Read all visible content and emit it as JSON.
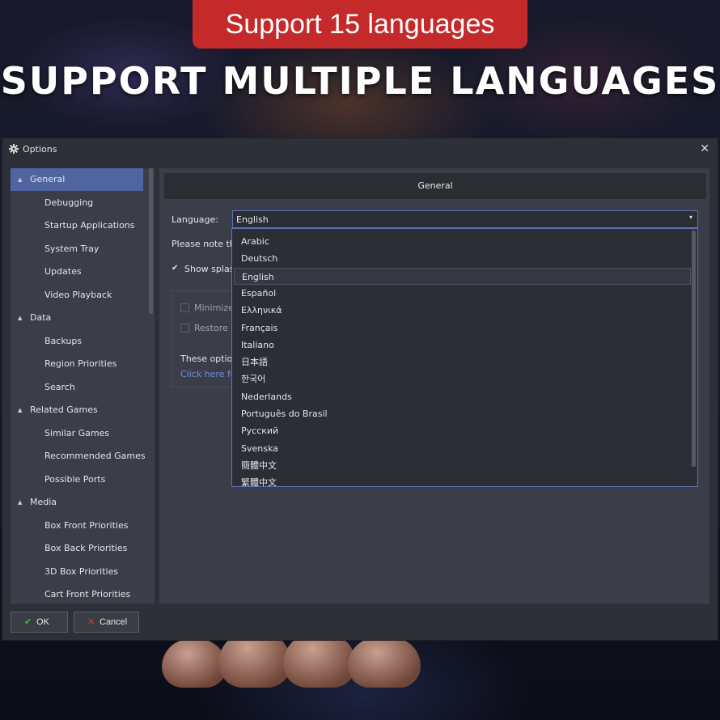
{
  "banner": {
    "badge_text": "Support 15 languages",
    "headline": "SUPPORT MULTIPLE LANGUAGES"
  },
  "dialog": {
    "title": "Options",
    "close_glyph": "✕"
  },
  "nav": {
    "items": [
      {
        "label": "General",
        "type": "category",
        "selected": true
      },
      {
        "label": "Debugging",
        "type": "sub"
      },
      {
        "label": "Startup Applications",
        "type": "sub"
      },
      {
        "label": "System Tray",
        "type": "sub"
      },
      {
        "label": "Updates",
        "type": "sub"
      },
      {
        "label": "Video Playback",
        "type": "sub"
      },
      {
        "label": "Data",
        "type": "category"
      },
      {
        "label": "Backups",
        "type": "sub"
      },
      {
        "label": "Region Priorities",
        "type": "sub"
      },
      {
        "label": "Search",
        "type": "sub"
      },
      {
        "label": "Related Games",
        "type": "category"
      },
      {
        "label": "Similar Games",
        "type": "sub"
      },
      {
        "label": "Recommended Games",
        "type": "sub"
      },
      {
        "label": "Possible Ports",
        "type": "sub"
      },
      {
        "label": "Media",
        "type": "category"
      },
      {
        "label": "Box Front Priorities",
        "type": "sub"
      },
      {
        "label": "Box Back Priorities",
        "type": "sub"
      },
      {
        "label": "3D Box Priorities",
        "type": "sub"
      },
      {
        "label": "Cart Front Priorities",
        "type": "sub"
      }
    ]
  },
  "general": {
    "header": "General",
    "language_label": "Language:",
    "language_value": "English",
    "note_text": "Please note that",
    "splash_label": "Show splash",
    "minimize_label": "Minimize",
    "restore_label": "Restore La",
    "these_options_text": "These options",
    "click_here_text": "Click here for"
  },
  "language_options": [
    "Arabic",
    "Deutsch",
    "English",
    "Español",
    "Ελληνικά",
    "Français",
    "Italiano",
    "日本語",
    "한국어",
    "Nederlands",
    "Português do Brasil",
    "Русский",
    "Svenska",
    "簡體中文",
    "繁體中文"
  ],
  "highlighted_option": "English",
  "buttons": {
    "ok_label": "OK",
    "cancel_label": "Cancel"
  },
  "colors": {
    "badge_red": "#c42a2a",
    "selection_blue": "#5065a0",
    "link_blue": "#6f8fd6",
    "ok_green": "#3bbd4a",
    "cancel_red": "#d13a3a"
  }
}
